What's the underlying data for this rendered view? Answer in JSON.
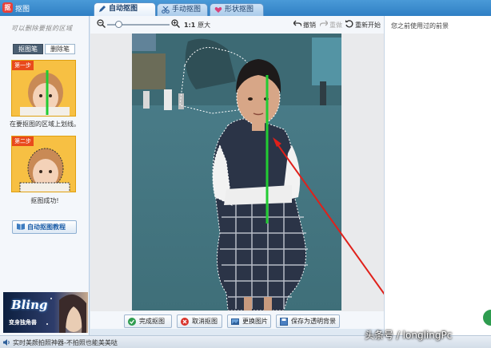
{
  "app": {
    "title": "抠图",
    "icon_text": "抠"
  },
  "tabs": [
    {
      "label": "自动抠图",
      "active": true
    },
    {
      "label": "手动抠图",
      "active": false
    },
    {
      "label": "形状抠图",
      "active": false
    }
  ],
  "left_panel": {
    "hint": "可以删除要抠的区域",
    "pens": [
      {
        "label": "抠图笔",
        "active": true
      },
      {
        "label": "删除笔",
        "active": false
      }
    ],
    "examples": [
      {
        "badge": "第一步",
        "caption": "在要抠图的区域上划线。"
      },
      {
        "badge": "第二步",
        "caption": "抠图成功!"
      }
    ],
    "tutorial_button": "自动抠图教程",
    "promo": {
      "title": "Bling",
      "subtitle": "变身独角兽"
    }
  },
  "toolbar": {
    "zoom_original": "1:1",
    "zoom_original_label": "原大",
    "undo": "撤销",
    "redo": "重做",
    "restart": "重新开始"
  },
  "actions": {
    "finish": "完成抠图",
    "cancel": "取消抠图",
    "change_image": "更换图片",
    "save_transparent": "保存为透明背景"
  },
  "right_panel": {
    "title": "您之前使用过的前景"
  },
  "status": {
    "text": "实时美颜拍照神器-不拍照也能美美哒"
  },
  "watermark": "头条号 / longlingPc",
  "colors": {
    "titlebar": "#2f7fc4",
    "stroke_green": "#22cc33",
    "arrow_red": "#e0201a",
    "badge_red": "#e94a1c"
  }
}
